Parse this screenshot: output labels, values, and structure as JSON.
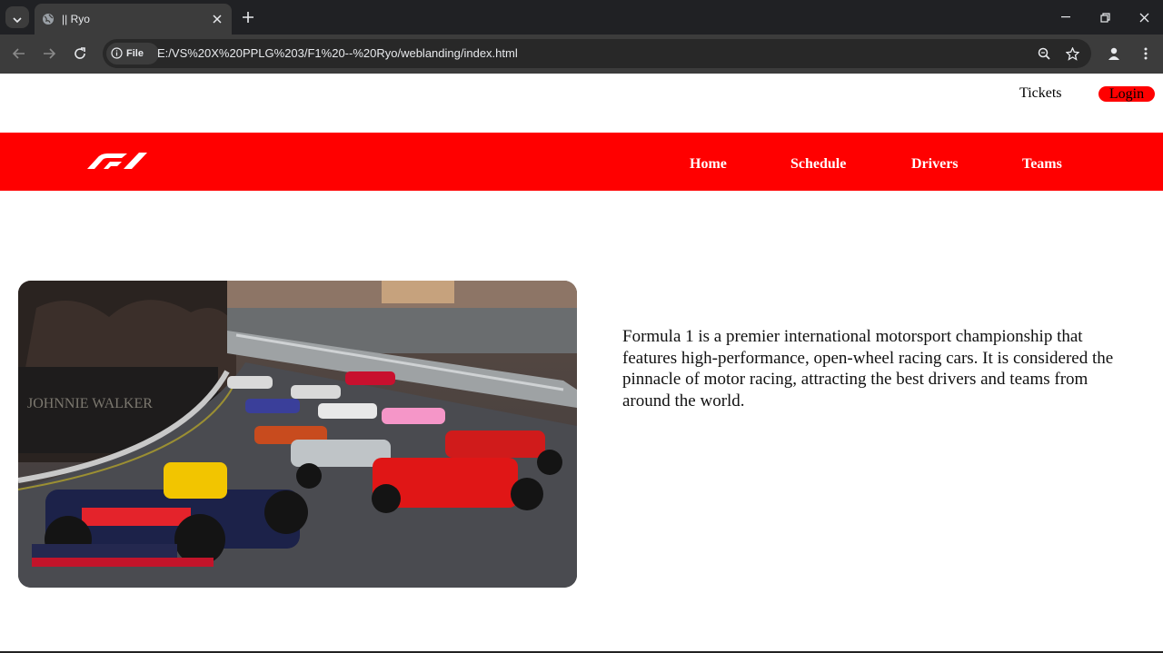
{
  "browser": {
    "tab_title": "|| Ryo",
    "site_info_label": "File",
    "url": "E:/VS%20X%20PPLG%203/F1%20--%20Ryo/weblanding/index.html"
  },
  "header": {
    "tickets_label": "Tickets",
    "login_label": "Login"
  },
  "navbar": {
    "logo": "f1-logo",
    "links": [
      "Home",
      "Schedule",
      "Drivers",
      "Teams"
    ]
  },
  "hero": {
    "image": "f1-race-cars-photo",
    "description": "Formula 1 is a premier international motorsport championship that features high-performance, open-wheel racing cars. It is considered the pinnacle of motor racing, attracting the best drivers and teams from around the world."
  },
  "colors": {
    "brand_red": "#ff0000",
    "chrome_dark": "#202124",
    "chrome_toolbar": "#3c3c3c"
  }
}
